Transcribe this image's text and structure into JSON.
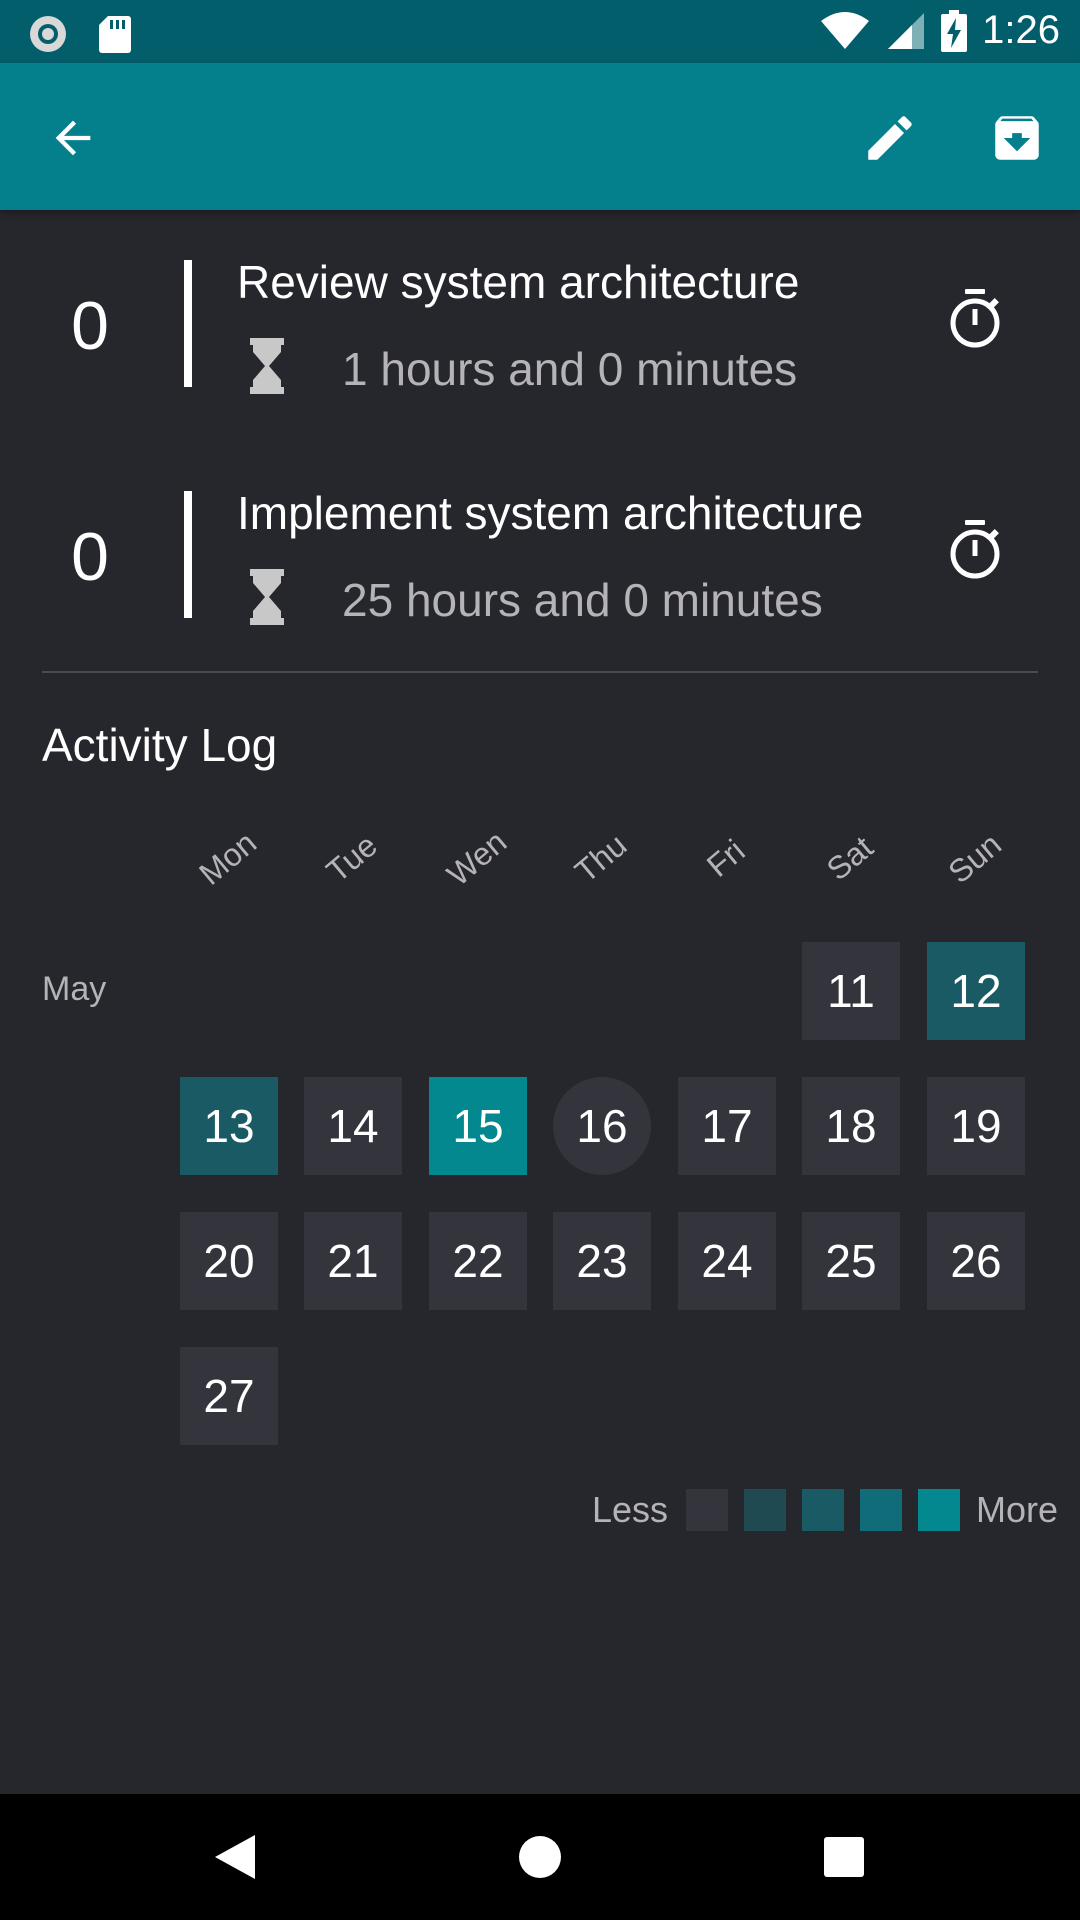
{
  "status_bar": {
    "time": "1:26"
  },
  "habits": [
    {
      "count": "0",
      "title": "Review system architecture",
      "duration": "1 hours and 0 minutes"
    },
    {
      "count": "0",
      "title": "Implement system architecture",
      "duration": "25 hours and 0 minutes"
    }
  ],
  "activity": {
    "title": "Activity Log",
    "weekdays": [
      "Mon",
      "Tue",
      "Wen",
      "Thu",
      "Fri",
      "Sat",
      "Sun"
    ],
    "month": "May",
    "days": [
      {
        "label": "11",
        "level": 0
      },
      {
        "label": "12",
        "level": 2
      },
      {
        "label": "13",
        "level": 2
      },
      {
        "label": "14",
        "level": 0
      },
      {
        "label": "15",
        "level": 4
      },
      {
        "label": "16",
        "level": 0,
        "today": true
      },
      {
        "label": "17",
        "level": 0
      },
      {
        "label": "18",
        "level": 0
      },
      {
        "label": "19",
        "level": 0
      },
      {
        "label": "20",
        "level": 0
      },
      {
        "label": "21",
        "level": 0
      },
      {
        "label": "22",
        "level": 0
      },
      {
        "label": "23",
        "level": 0
      },
      {
        "label": "24",
        "level": 0
      },
      {
        "label": "25",
        "level": 0
      },
      {
        "label": "26",
        "level": 0
      },
      {
        "label": "27",
        "level": 0
      }
    ],
    "legend": {
      "less": "Less",
      "more": "More"
    }
  },
  "colors": {
    "app_bar": "#03808c",
    "status_bar": "#035e6b",
    "background": "#26262d",
    "level_0": "#34343d",
    "level_1": "#1f4a52",
    "level_2": "#1a5a64",
    "level_3": "#0f6c78",
    "level_4": "#04888f"
  },
  "icons": {
    "back": "arrow-left-icon",
    "edit": "pencil-icon",
    "archive": "archive-icon",
    "timer": "stopwatch-icon",
    "duration": "hourglass-icon"
  }
}
